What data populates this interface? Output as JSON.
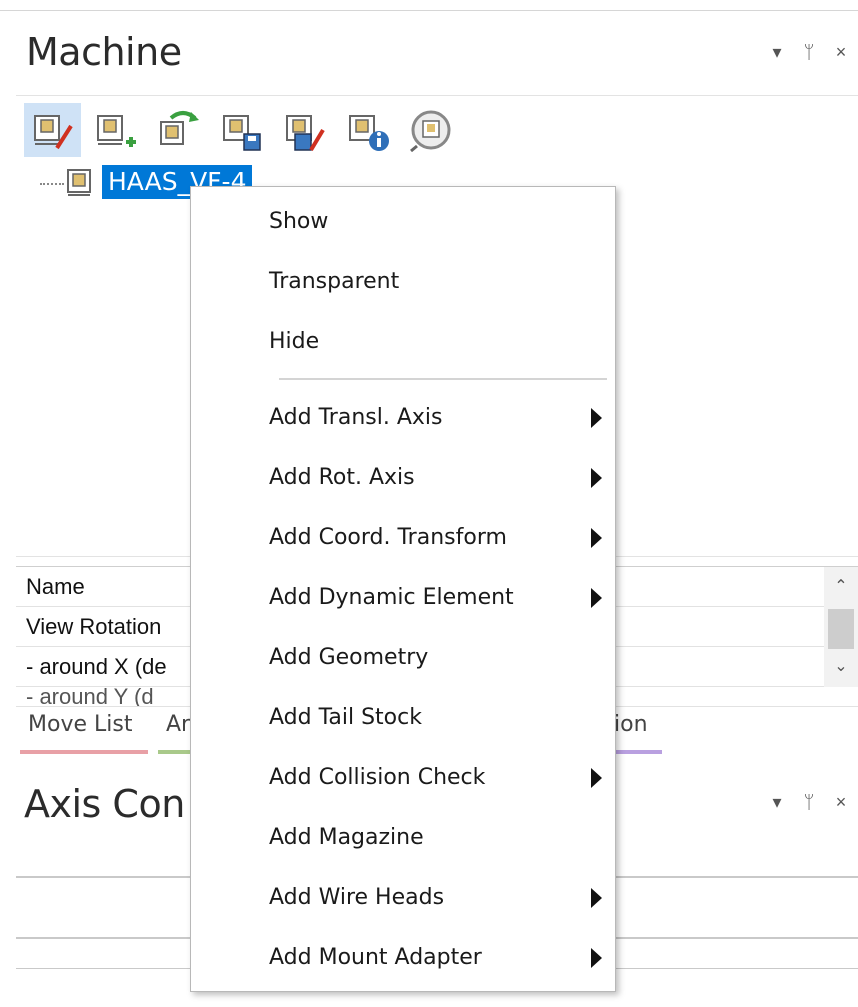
{
  "machine_panel": {
    "title": "Machine",
    "tree": {
      "root_label": "HAAS_VF-4"
    },
    "toolbar_icons": [
      "edit-machine-icon",
      "add-machine-icon",
      "reload-machine-icon",
      "save-machine-icon",
      "save-edit-machine-icon",
      "machine-info-icon",
      "machine-search-icon"
    ]
  },
  "property_grid": {
    "header": "Name",
    "rows": [
      "View Rotation",
      "- around X (de",
      "- around Y (d"
    ]
  },
  "tabs": [
    {
      "label": "Move List",
      "color": "#e8a0a6"
    },
    {
      "label": "Ar",
      "color": "#a9c98a"
    },
    {
      "label": "ion",
      "color": "#b9a0e0"
    }
  ],
  "axis_panel": {
    "title": "Axis Con"
  },
  "context_menu": {
    "items": [
      {
        "label": "Show",
        "submenu": false
      },
      {
        "label": "Transparent",
        "submenu": false
      },
      {
        "label": "Hide",
        "submenu": false
      },
      {
        "label": "Add Transl. Axis",
        "submenu": true
      },
      {
        "label": "Add Rot. Axis",
        "submenu": true
      },
      {
        "label": "Add Coord. Transform",
        "submenu": true
      },
      {
        "label": "Add Dynamic Element",
        "submenu": true
      },
      {
        "label": "Add Geometry",
        "submenu": false
      },
      {
        "label": "Add Tail Stock",
        "submenu": false
      },
      {
        "label": "Add Collision Check",
        "submenu": true
      },
      {
        "label": "Add Magazine",
        "submenu": false
      },
      {
        "label": "Add Wire Heads",
        "submenu": true
      },
      {
        "label": "Add Mount Adapter",
        "submenu": true
      }
    ]
  },
  "panel_controls": {
    "dropdown": "▾",
    "pin": "ᛘ",
    "close": "×"
  },
  "colors": {
    "selection": "#0078d7",
    "toolbar_active": "#cfe2f6"
  }
}
